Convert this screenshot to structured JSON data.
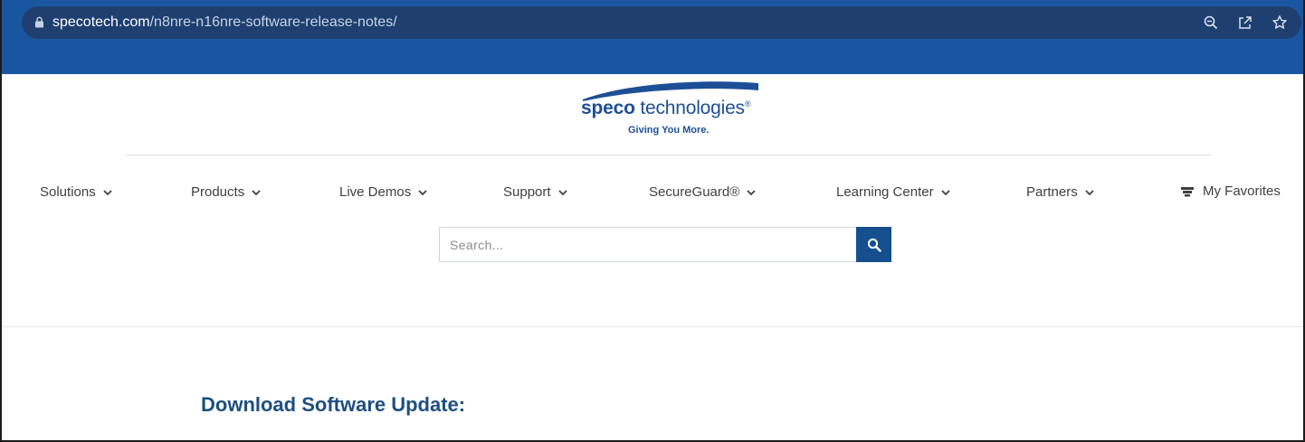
{
  "browser": {
    "url_host": "specotech.com",
    "url_path": "/n8nre-n16nre-software-release-notes/",
    "actions": [
      "zoom-icon",
      "share-icon",
      "bookmark-star-icon"
    ]
  },
  "logo": {
    "brand_bold": "speco",
    "brand_light": " technologies",
    "registered": "®",
    "tagline": "Giving You More."
  },
  "nav": {
    "items": [
      {
        "label": "Solutions"
      },
      {
        "label": "Products"
      },
      {
        "label": "Live Demos"
      },
      {
        "label": "Support"
      },
      {
        "label": "SecureGuard®"
      },
      {
        "label": "Learning Center"
      },
      {
        "label": "Partners"
      }
    ],
    "favorites": "My Favorites"
  },
  "search": {
    "placeholder": "Search..."
  },
  "main": {
    "heading": "Download Software Update:"
  },
  "colors": {
    "chrome_blue": "#1a56a0",
    "urlbar_blue": "#1e3f70",
    "brand_blue": "#1d4f96",
    "search_button": "#154f8d",
    "heading_blue": "#1d4f80"
  }
}
